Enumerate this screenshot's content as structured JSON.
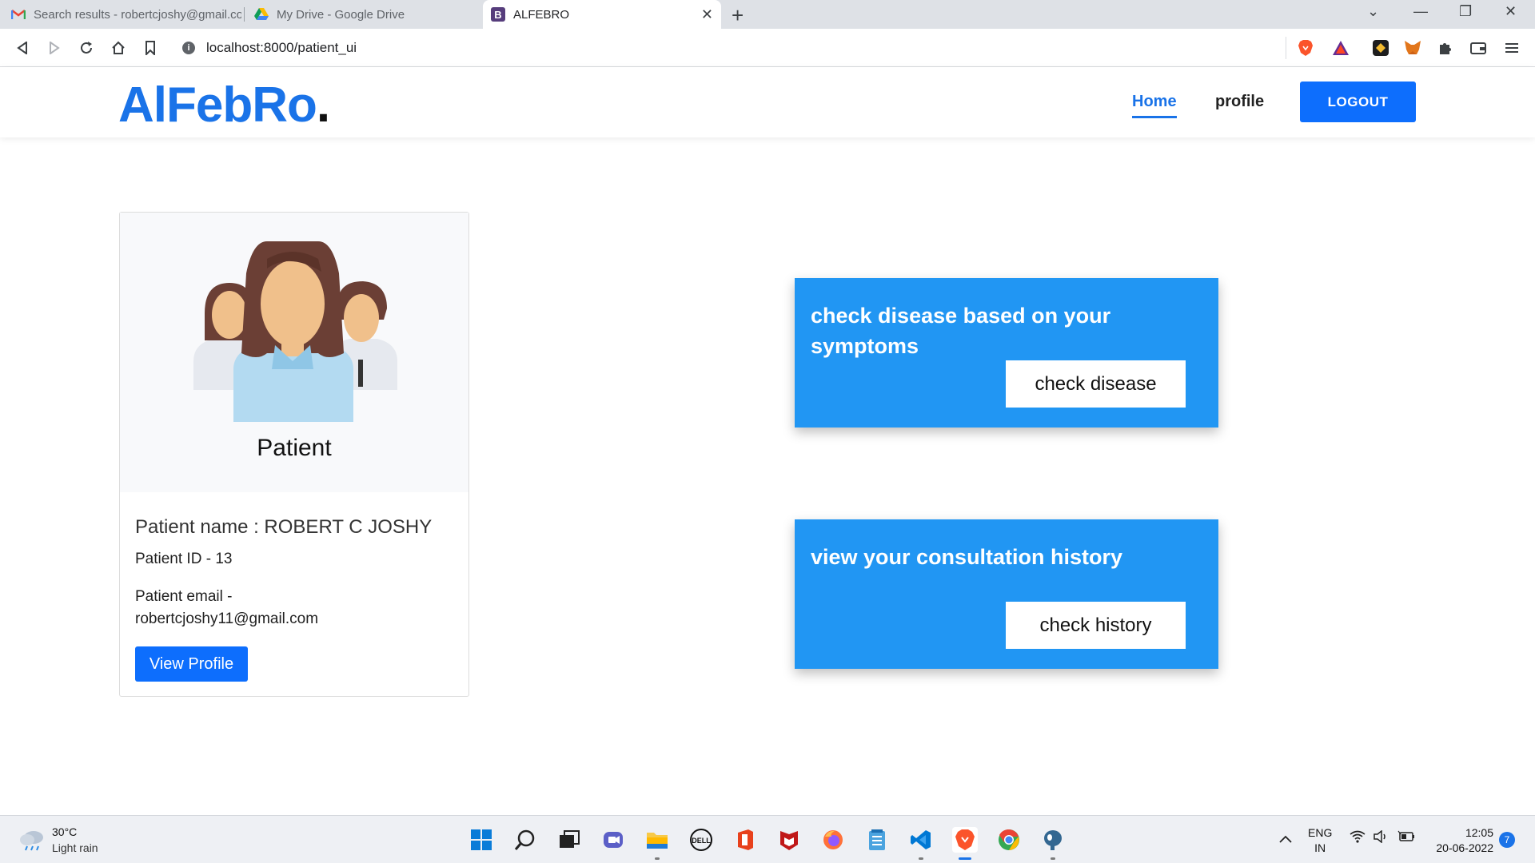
{
  "browser": {
    "tabs": [
      {
        "label": "Search results - robertcjoshy@gmail.com - Gmail"
      },
      {
        "label": "My Drive - Google Drive"
      },
      {
        "label": "ALFEBRO"
      }
    ],
    "url": "localhost:8000/patient_ui"
  },
  "site": {
    "logo_text": "AlFebRo",
    "logo_dot": ".",
    "nav": {
      "home": "Home",
      "profile": "profile",
      "logout": "LOGOUT"
    },
    "brand_color": "#1a73e8"
  },
  "patient_card": {
    "title": "Patient",
    "name_line": "Patient name : ROBERT C JOSHY",
    "id_line": "Patient ID - 13",
    "email_label": "Patient email -",
    "email_value": "robertcjoshy11@gmail.com",
    "view_profile": "View Profile"
  },
  "actions": [
    {
      "heading": "check disease based on your symptoms",
      "button": "check disease"
    },
    {
      "heading": "view your consultation history",
      "button": "check history"
    }
  ],
  "taskbar": {
    "weather_temp": "30°C",
    "weather_desc": "Light rain",
    "lang_top": "ENG",
    "lang_bottom": "IN",
    "time": "12:05",
    "date": "20-06-2022",
    "notifications": "7",
    "apps": [
      "start-icon",
      "search-icon",
      "task-view-icon",
      "teams-icon",
      "file-explorer-icon",
      "dell-icon",
      "office-icon",
      "mcafee-icon",
      "firefox-icon",
      "notepad-icon",
      "vscode-icon",
      "brave-icon",
      "chrome-icon",
      "postgres-icon"
    ]
  }
}
